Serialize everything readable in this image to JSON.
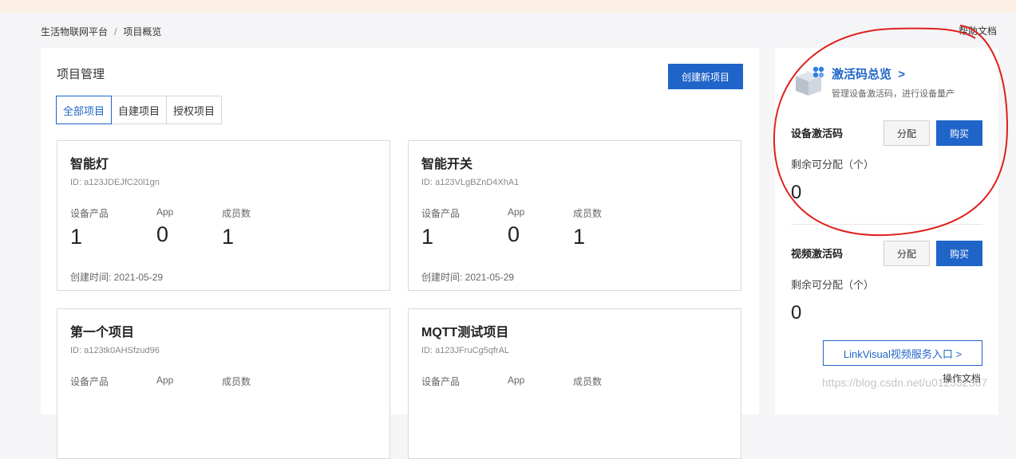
{
  "breadcrumb": {
    "root": "生活物联网平台",
    "separator": "/",
    "current": "项目概览"
  },
  "help_link": "帮助文档",
  "project_panel": {
    "title": "项目管理",
    "create_button": "创建新项目",
    "tabs": [
      {
        "label": "全部项目"
      },
      {
        "label": "自建项目"
      },
      {
        "label": "授权项目"
      }
    ],
    "stat_labels": {
      "products": "设备产品",
      "app": "App",
      "members": "成员数"
    },
    "projects": [
      {
        "name": "智能灯",
        "id": "ID: a123JDEJfC20l1gn",
        "products": "1",
        "app": "0",
        "members": "1",
        "created": "创建时间: 2021-05-29"
      },
      {
        "name": "智能开关",
        "id": "ID: a123VLgBZnD4XhA1",
        "products": "1",
        "app": "0",
        "members": "1",
        "created": "创建时间: 2021-05-29"
      },
      {
        "name": "第一个项目",
        "id": "ID: a123tk0AHSfzud96"
      },
      {
        "name": "MQTT测试项目",
        "id": "ID: a123JFruCg5qfrAL"
      }
    ]
  },
  "activation_panel": {
    "title": "激活码总览",
    "title_chevron": ">",
    "subtitle": "管理设备激活码，进行设备量产",
    "device": {
      "title": "设备激活码",
      "allocate": "分配",
      "buy": "购买",
      "remain_label": "剩余可分配（个）",
      "remain_value": "0"
    },
    "video": {
      "title": "视频激活码",
      "allocate": "分配",
      "buy": "购买",
      "remain_label": "剩余可分配（个）",
      "remain_value": "0"
    },
    "linkvisual_button": "LinkVisual视频服务入口 >",
    "docs_link": "操作文档"
  },
  "watermark": "https://blog.csdn.net/u012332367",
  "colors": {
    "primary": "#1f64c8",
    "annotation": "#e0201c",
    "topbar": "#fbefe3"
  }
}
